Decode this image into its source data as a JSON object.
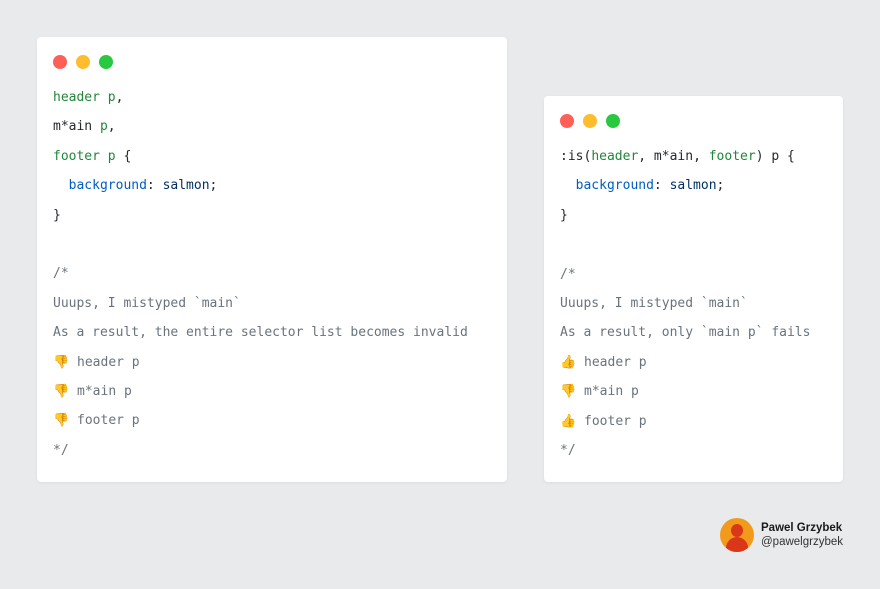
{
  "left": {
    "lines": [
      [
        {
          "t": "header p",
          "c": "sel"
        },
        {
          "t": ",",
          "c": "punc"
        }
      ],
      [
        {
          "t": "m*ain ",
          "c": "punc"
        },
        {
          "t": "p",
          "c": "sel"
        },
        {
          "t": ",",
          "c": "punc"
        }
      ],
      [
        {
          "t": "footer p",
          "c": "sel"
        },
        {
          "t": " {",
          "c": "punc"
        }
      ],
      [
        {
          "t": "  background",
          "c": "prop"
        },
        {
          "t": ": ",
          "c": "punc"
        },
        {
          "t": "salmon",
          "c": "val"
        },
        {
          "t": ";",
          "c": "punc"
        }
      ],
      [
        {
          "t": "}",
          "c": "punc"
        }
      ],
      [],
      [
        {
          "t": "/*",
          "c": "cmt"
        }
      ],
      [
        {
          "t": "Uuups, I mistyped `main`",
          "c": "cmt"
        }
      ],
      [
        {
          "t": "As a result, the entire selector list becomes invalid",
          "c": "cmt"
        }
      ],
      [
        {
          "t": "👎",
          "c": "emo"
        },
        {
          "t": " header p",
          "c": "cmt"
        }
      ],
      [
        {
          "t": "👎",
          "c": "emo"
        },
        {
          "t": " m*ain p",
          "c": "cmt"
        }
      ],
      [
        {
          "t": "👎",
          "c": "emo"
        },
        {
          "t": " footer p",
          "c": "cmt"
        }
      ],
      [
        {
          "t": "*/",
          "c": "cmt"
        }
      ]
    ]
  },
  "right": {
    "lines": [
      [
        {
          "t": ":is(",
          "c": "punc"
        },
        {
          "t": "header",
          "c": "sel"
        },
        {
          "t": ", m*ain, ",
          "c": "punc"
        },
        {
          "t": "footer",
          "c": "sel"
        },
        {
          "t": ") p {",
          "c": "punc"
        }
      ],
      [
        {
          "t": "  background",
          "c": "prop"
        },
        {
          "t": ": ",
          "c": "punc"
        },
        {
          "t": "salmon",
          "c": "val"
        },
        {
          "t": ";",
          "c": "punc"
        }
      ],
      [
        {
          "t": "}",
          "c": "punc"
        }
      ],
      [],
      [
        {
          "t": "/*",
          "c": "cmt"
        }
      ],
      [
        {
          "t": "Uuups, I mistyped `main`",
          "c": "cmt"
        }
      ],
      [
        {
          "t": "As a result, only `main p` fails",
          "c": "cmt"
        }
      ],
      [
        {
          "t": "👍",
          "c": "emo"
        },
        {
          "t": " header p",
          "c": "cmt"
        }
      ],
      [
        {
          "t": "👎",
          "c": "emo"
        },
        {
          "t": " m*ain p",
          "c": "cmt"
        }
      ],
      [
        {
          "t": "👍",
          "c": "emo"
        },
        {
          "t": " footer p",
          "c": "cmt"
        }
      ],
      [
        {
          "t": "*/",
          "c": "cmt"
        }
      ]
    ]
  },
  "author": {
    "name": "Pawel Grzybek",
    "handle": "@pawelgrzybek"
  },
  "colors": {
    "background": "#e9eaec",
    "selector": "#22863a",
    "property": "#005cc5",
    "value": "#032f62",
    "comment": "#6a737d",
    "red_dot": "#fe5f57",
    "yellow_dot": "#febc2e",
    "green_dot": "#28c840",
    "avatar": "#f29a1c"
  }
}
